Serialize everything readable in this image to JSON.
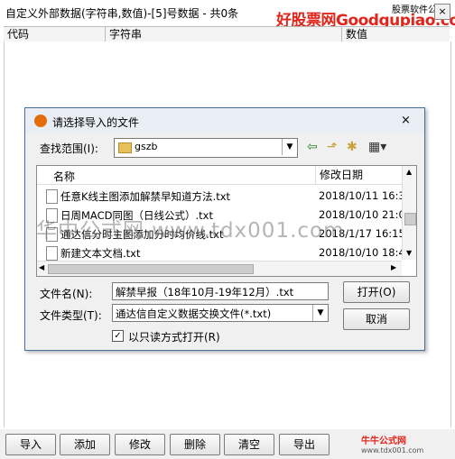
{
  "window": {
    "title": "自定义外部数据(字符串,数值)-[5]号数据 - 共0条",
    "brand": "好股票网Goodgupiao.com",
    "brand_sub": "股票软件公式",
    "close": "×"
  },
  "grid": {
    "columns": [
      "代码",
      "字符串",
      "数值"
    ]
  },
  "dialog": {
    "title": "请选择导入的文件",
    "close": "×",
    "lookin_label": "查找范围(I):",
    "lookin_value": "gszb",
    "list_headers": {
      "name": "名称",
      "date": "修改日期"
    },
    "files": [
      {
        "name": "任意K线主图添加解禁早知道方法.txt",
        "date": "2018/10/11 16:3"
      },
      {
        "name": "日周MACD同图（日线公式）.txt",
        "date": "2018/10/10 21:0"
      },
      {
        "name": "通达信分时主图添加分时均价线.txt",
        "date": "2018/1/17 16:15"
      },
      {
        "name": "新建文本文档.txt",
        "date": "2018/10/10 18:4"
      }
    ],
    "filename_label": "文件名(N):",
    "filename_value": "解禁早报（18年10月-19年12月）.txt",
    "filetype_label": "文件类型(T):",
    "filetype_value": "通达信自定义数据交换文件(*.txt)",
    "open_button": "打开(O)",
    "cancel_button": "取消",
    "readonly_label": "以只读方式打开(R)"
  },
  "watermark": "华中公式网 www.tdx001.com",
  "toolbar": {
    "buttons": [
      "导入",
      "添加",
      "修改",
      "删除",
      "清空",
      "导出"
    ]
  },
  "logo_small": {
    "name": "牛牛公式网",
    "url": "www.tdx001.com"
  }
}
